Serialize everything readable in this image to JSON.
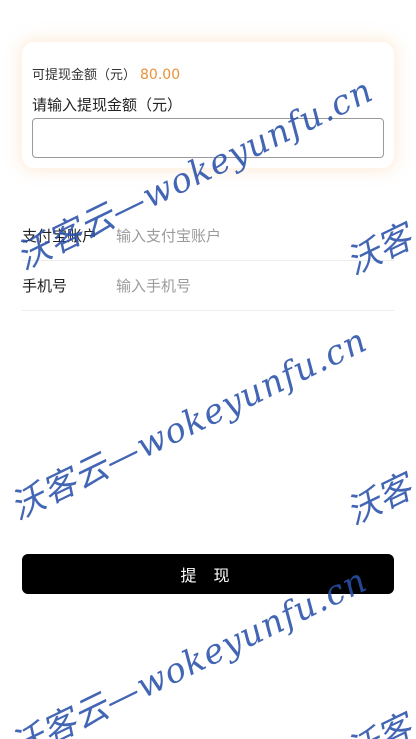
{
  "balance_card": {
    "available_label": "可提现金额（元）",
    "available_amount": "80.00",
    "input_label": "请输入提现金额（元）",
    "input_value": "",
    "input_placeholder": ""
  },
  "form": {
    "alipay": {
      "label": "支付宝账户",
      "placeholder": "输入支付宝账户",
      "value": ""
    },
    "phone": {
      "label": "手机号",
      "placeholder": "输入手机号",
      "value": ""
    }
  },
  "actions": {
    "submit_label": "提 现"
  },
  "watermark": {
    "text": "沃客云—wokeyunfu.cn",
    "edge_text": "沃客"
  },
  "colors": {
    "amount": "#e8913a",
    "button_bg": "#000000",
    "button_text": "#ffffff",
    "watermark": "#2850aa"
  }
}
